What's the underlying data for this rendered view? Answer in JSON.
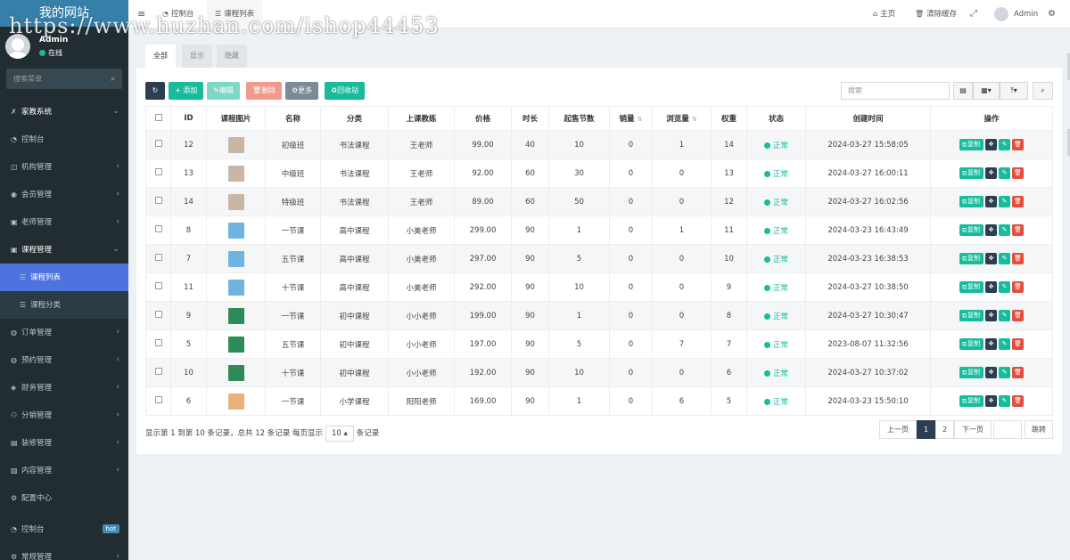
{
  "sidebar": {
    "site_title": "我的网站",
    "user": {
      "name": "Admin",
      "status": "在线"
    },
    "search_placeholder": "搜索菜单",
    "items": [
      {
        "label": "家教系统",
        "icon": "wrench-icon",
        "open": true
      },
      {
        "label": "控制台",
        "icon": "dashboard-icon"
      },
      {
        "label": "机构管理",
        "icon": "book-icon"
      },
      {
        "label": "会员管理",
        "icon": "user-icon"
      },
      {
        "label": "老师管理",
        "icon": "teacher-icon"
      },
      {
        "label": "课程管理",
        "icon": "course-icon",
        "open": true
      },
      {
        "label": "课程列表",
        "icon": "list-icon",
        "active": true
      },
      {
        "label": "课程分类",
        "icon": "list-icon"
      },
      {
        "label": "订单管理",
        "icon": "order-icon"
      },
      {
        "label": "预约管理",
        "icon": "calendar-icon"
      },
      {
        "label": "财务管理",
        "icon": "finance-icon"
      },
      {
        "label": "分销管理",
        "icon": "users-icon"
      },
      {
        "label": "装修管理",
        "icon": "decorate-icon"
      },
      {
        "label": "内容管理",
        "icon": "content-icon"
      },
      {
        "label": "配置中心",
        "icon": "gear-icon"
      },
      {
        "label": "控制台",
        "icon": "dashboard-icon",
        "badge": "hot"
      },
      {
        "label": "常规管理",
        "icon": "cog-icon"
      }
    ]
  },
  "topbar": {
    "tabs": [
      {
        "label": "控制台",
        "icon": "dashboard-icon"
      },
      {
        "label": "课程列表",
        "icon": "list-icon",
        "active": true
      }
    ],
    "home": "主页",
    "clear_cache": "清除缓存",
    "user": "Admin"
  },
  "watermark": "https://www.huzhan.com/ishop44453",
  "content_tabs": [
    "全部",
    "显示",
    "隐藏"
  ],
  "toolbar": {
    "add": "添加",
    "edit": "编辑",
    "delete": "删除",
    "more": "更多",
    "recycle": "回收站",
    "search_placeholder": "搜索"
  },
  "table": {
    "headers": [
      "ID",
      "课程图片",
      "名称",
      "分类",
      "上课教练",
      "价格",
      "时长",
      "起售节数",
      "销量",
      "浏览量",
      "权重",
      "状态",
      "创建时间",
      "操作"
    ],
    "rows": [
      {
        "id": "12",
        "thumb": "#c8b7a6",
        "name": "初级班",
        "category": "书法课程",
        "coach": "王老师",
        "price": "99.00",
        "duration": "40",
        "min": "10",
        "sales": "0",
        "views": "1",
        "weight": "14",
        "status": "正常",
        "created": "2024-03-27 15:58:05"
      },
      {
        "id": "13",
        "thumb": "#c8b7a6",
        "name": "中级班",
        "category": "书法课程",
        "coach": "王老师",
        "price": "92.00",
        "duration": "60",
        "min": "30",
        "sales": "0",
        "views": "0",
        "weight": "13",
        "status": "正常",
        "created": "2024-03-27 16:00:11"
      },
      {
        "id": "14",
        "thumb": "#c8b7a6",
        "name": "特级班",
        "category": "书法课程",
        "coach": "王老师",
        "price": "89.00",
        "duration": "60",
        "min": "50",
        "sales": "0",
        "views": "0",
        "weight": "12",
        "status": "正常",
        "created": "2024-03-27 16:02:56"
      },
      {
        "id": "8",
        "thumb": "#6fb3e0",
        "name": "一节课",
        "category": "高中课程",
        "coach": "小美老师",
        "price": "299.00",
        "duration": "90",
        "min": "1",
        "sales": "0",
        "views": "1",
        "weight": "11",
        "status": "正常",
        "created": "2024-03-23 16:43:49"
      },
      {
        "id": "7",
        "thumb": "#6fb3e0",
        "name": "五节课",
        "category": "高中课程",
        "coach": "小美老师",
        "price": "297.00",
        "duration": "90",
        "min": "5",
        "sales": "0",
        "views": "0",
        "weight": "10",
        "status": "正常",
        "created": "2024-03-23 16:38:53"
      },
      {
        "id": "11",
        "thumb": "#6fb3e0",
        "name": "十节课",
        "category": "高中课程",
        "coach": "小美老师",
        "price": "292.00",
        "duration": "90",
        "min": "10",
        "sales": "0",
        "views": "0",
        "weight": "9",
        "status": "正常",
        "created": "2024-03-27 10:38:50"
      },
      {
        "id": "9",
        "thumb": "#2e8b57",
        "name": "一节课",
        "category": "初中课程",
        "coach": "小小老师",
        "price": "199.00",
        "duration": "90",
        "min": "1",
        "sales": "0",
        "views": "0",
        "weight": "8",
        "status": "正常",
        "created": "2024-03-27 10:30:47"
      },
      {
        "id": "5",
        "thumb": "#2e8b57",
        "name": "五节课",
        "category": "初中课程",
        "coach": "小小老师",
        "price": "197.00",
        "duration": "90",
        "min": "5",
        "sales": "0",
        "views": "7",
        "weight": "7",
        "status": "正常",
        "created": "2023-08-07 11:32:56"
      },
      {
        "id": "10",
        "thumb": "#2e8b57",
        "name": "十节课",
        "category": "初中课程",
        "coach": "小小老师",
        "price": "192.00",
        "duration": "90",
        "min": "10",
        "sales": "0",
        "views": "0",
        "weight": "6",
        "status": "正常",
        "created": "2024-03-27 10:37:02"
      },
      {
        "id": "6",
        "thumb": "#e8b07a",
        "name": "一节课",
        "category": "小学课程",
        "coach": "阳阳老师",
        "price": "169.00",
        "duration": "90",
        "min": "1",
        "sales": "0",
        "views": "6",
        "weight": "5",
        "status": "正常",
        "created": "2024-03-23 15:50:10"
      }
    ],
    "op_copy": "复制"
  },
  "footer": {
    "info_prefix": "显示第 1 到第 10 条记录，总共 12 条记录 每页显示",
    "page_size": "10",
    "info_suffix": "条记录",
    "prev": "上一页",
    "pages": [
      "1",
      "2"
    ],
    "next": "下一页",
    "jump": "跳转"
  }
}
